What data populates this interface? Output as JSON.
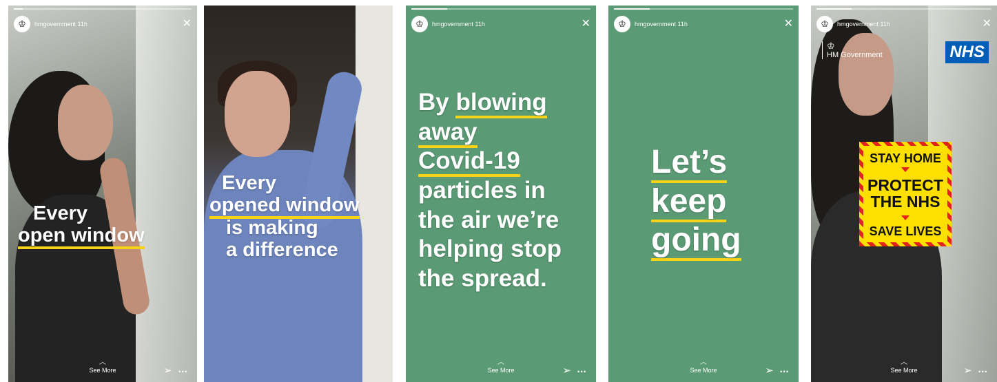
{
  "account": {
    "handle": "hmgovernment",
    "time": "11h"
  },
  "footer": {
    "see_more": "See More"
  },
  "icons": {
    "close": "close-icon",
    "send": "send-icon",
    "more": "more-icon",
    "chevron": "chevron-up-icon",
    "avatar": "crest-icon"
  },
  "colors": {
    "underline": "#f6d316",
    "story_green": "#5a9a74",
    "nhs_blue": "#005eb8",
    "badge_yellow": "#fde000",
    "badge_red": "#e0231b"
  },
  "stories": [
    {
      "progress": 0.05,
      "headline": [
        "Every",
        "open window"
      ]
    },
    {
      "progress": 0.25,
      "headline": [
        "Every",
        "opened window",
        "is making",
        "a difference"
      ]
    },
    {
      "progress": 0.2,
      "headline": [
        "By blowing",
        "away",
        "Covid-19",
        "particles in",
        "the air we’re",
        "helping stop",
        "the spread."
      ]
    },
    {
      "progress": 0.2,
      "headline": [
        "Let’s",
        "keep",
        "going"
      ]
    },
    {
      "progress": 0.2,
      "logo_text": "HM Government",
      "nhs": "NHS",
      "badge": {
        "line1": "STAY HOME",
        "line2": "PROTECT",
        "line3": "THE NHS",
        "line4": "SAVE LIVES"
      }
    }
  ]
}
